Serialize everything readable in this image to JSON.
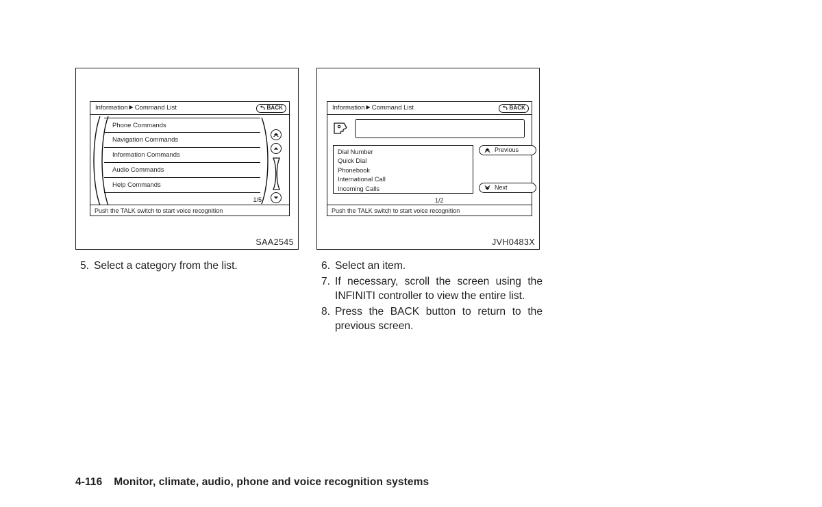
{
  "page": {
    "number": "4-116",
    "section_title": "Monitor, climate, audio, phone and voice recognition systems"
  },
  "figures": [
    {
      "code": "SAA2545",
      "screen": {
        "breadcrumb": {
          "root": "Information",
          "separator": "▶",
          "leaf": "Command List"
        },
        "back_button": {
          "label": "BACK",
          "icon": "back-arrow-icon"
        },
        "list_items": [
          "Phone Commands",
          "Navigation Commands",
          "Information Commands",
          "Audio Commands",
          "Help Commands"
        ],
        "page_indicator": "1/5",
        "status_text": "Push the TALK switch to start voice recognition",
        "scroll_controls": [
          {
            "name": "scroll-top-button",
            "icon": "double-chevron-up-icon"
          },
          {
            "name": "scroll-up-button",
            "icon": "chevron-up-icon"
          },
          {
            "name": "scrollbar-thumb",
            "icon": "scrollbar-icon"
          },
          {
            "name": "scroll-down-button",
            "icon": "chevron-down-icon"
          },
          {
            "name": "scroll-bottom-button",
            "icon": "double-chevron-down-icon"
          }
        ]
      }
    },
    {
      "code": "JVH0483X",
      "screen": {
        "breadcrumb": {
          "root": "Information",
          "separator": "▶",
          "leaf": "Command List"
        },
        "back_button": {
          "label": "BACK",
          "icon": "back-arrow-icon"
        },
        "voice_icon": "speaking-head-icon",
        "command_input_value": "",
        "list_items": [
          "Dial Number",
          "Quick Dial",
          "Phonebook",
          "International Call",
          "Incoming Calls"
        ],
        "page_indicator": "1/2",
        "status_text": "Push the TALK switch to start voice recognition",
        "previous_button": {
          "label": "Previous",
          "icon": "double-chevron-up-icon"
        },
        "next_button": {
          "label": "Next",
          "icon": "double-chevron-down-icon"
        }
      }
    }
  ],
  "steps_left": [
    {
      "num": "5.",
      "text": "Select a category from the list."
    }
  ],
  "steps_right": [
    {
      "num": "6.",
      "text": "Select an item."
    },
    {
      "num": "7.",
      "text": "If necessary, scroll the screen using the INFINITI controller to view the entire list."
    },
    {
      "num": "8.",
      "text": "Press the BACK button to return to the previous screen."
    }
  ],
  "colors": {
    "ink": "#231f20",
    "line": "#111111",
    "paper": "#ffffff"
  }
}
